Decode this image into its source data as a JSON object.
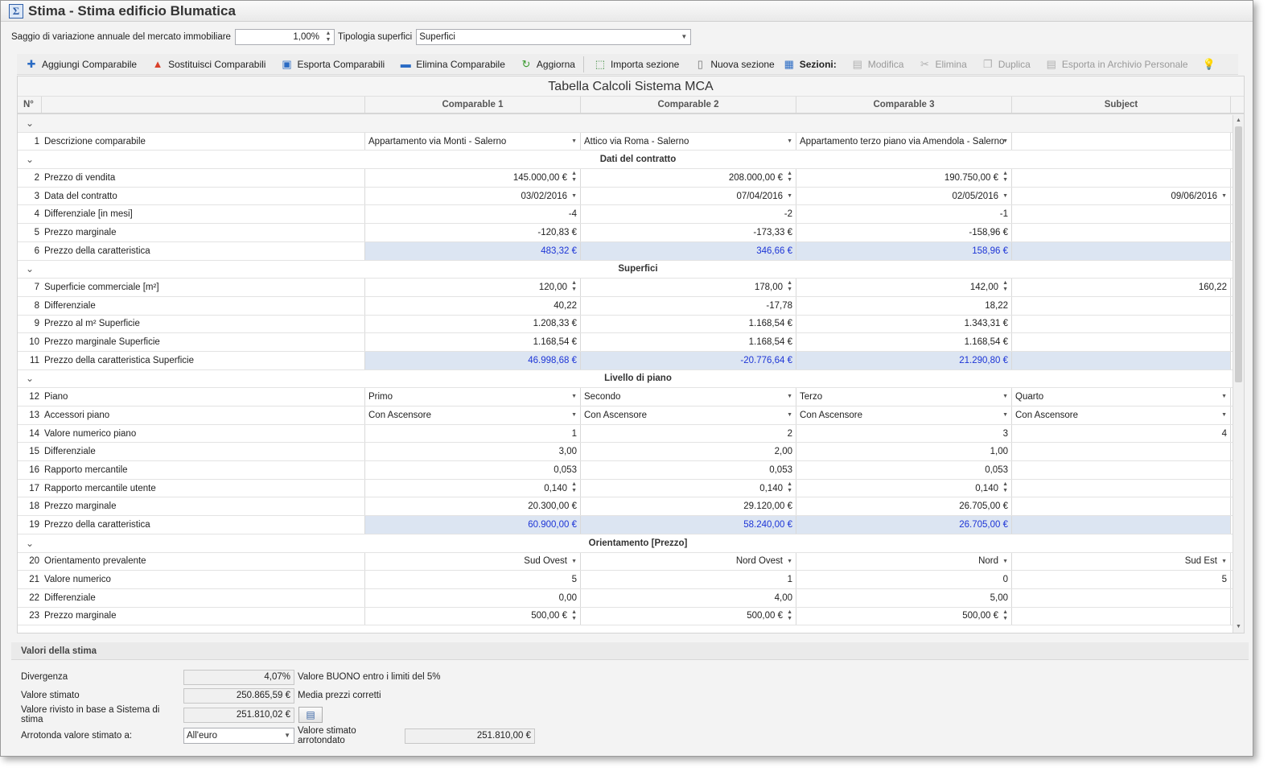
{
  "window": {
    "title": "Stima - Stima edificio Blumatica",
    "app_icon": "sigma-icon"
  },
  "filters": {
    "rate_label": "Saggio di variazione annuale del mercato immobiliare",
    "rate_value": "1,00%",
    "surface_label": "Tipologia superfici",
    "surface_value": "Superfici"
  },
  "toolbar": {
    "add": "Aggiungi Comparabile",
    "replace": "Sostituisci Comparabili",
    "export": "Esporta Comparabili",
    "delete": "Elimina Comparabile",
    "refresh": "Aggiorna",
    "import_section": "Importa sezione",
    "new_section": "Nuova sezione",
    "sections": "Sezioni:",
    "edit": "Modifica",
    "remove": "Elimina",
    "duplicate": "Duplica",
    "archive": "Esporta in Archivio Personale"
  },
  "grid": {
    "caption": "Tabella Calcoli Sistema MCA",
    "headers": {
      "num": "N°",
      "c1": "Comparable 1",
      "c2": "Comparable 2",
      "c3": "Comparable 3",
      "subject": "Subject"
    },
    "collapse_glyph": "⌄",
    "sections": {
      "contratto": "Dati del contratto",
      "superfici": "Superfici",
      "piano": "Livello di piano",
      "orientamento": "Orientamento [Prezzo]"
    },
    "rows": {
      "r1": {
        "n": "1",
        "d": "Descrizione comparabile",
        "c1": "Appartamento via Monti - Salerno",
        "c2": "Attico via Roma - Salerno",
        "c3": "Appartamento terzo piano via Amendola - Salerno",
        "s": ""
      },
      "r2": {
        "n": "2",
        "d": "Prezzo di vendita",
        "c1": "145.000,00 €",
        "c2": "208.000,00 €",
        "c3": "190.750,00 €",
        "s": ""
      },
      "r3": {
        "n": "3",
        "d": "Data del contratto",
        "c1": "03/02/2016",
        "c2": "07/04/2016",
        "c3": "02/05/2016",
        "s": "09/06/2016"
      },
      "r4": {
        "n": "4",
        "d": "Differenziale [in mesi]",
        "c1": "-4",
        "c2": "-2",
        "c3": "-1",
        "s": ""
      },
      "r5": {
        "n": "5",
        "d": "Prezzo marginale",
        "c1": "-120,83 €",
        "c2": "-173,33 €",
        "c3": "-158,96 €",
        "s": ""
      },
      "r6": {
        "n": "6",
        "d": "Prezzo della caratteristica",
        "c1": "483,32 €",
        "c2": "346,66 €",
        "c3": "158,96 €",
        "s": ""
      },
      "r7": {
        "n": "7",
        "d": "Superficie commerciale [m²]",
        "c1": "120,00",
        "c2": "178,00",
        "c3": "142,00",
        "s": "160,22"
      },
      "r8": {
        "n": "8",
        "d": "Differenziale",
        "c1": "40,22",
        "c2": "-17,78",
        "c3": "18,22",
        "s": ""
      },
      "r9": {
        "n": "9",
        "d": "Prezzo al m² Superficie",
        "c1": "1.208,33 €",
        "c2": "1.168,54 €",
        "c3": "1.343,31 €",
        "s": ""
      },
      "r10": {
        "n": "10",
        "d": "Prezzo marginale Superficie",
        "c1": "1.168,54 €",
        "c2": "1.168,54 €",
        "c3": "1.168,54 €",
        "s": ""
      },
      "r11": {
        "n": "11",
        "d": "Prezzo della caratteristica Superficie",
        "c1": "46.998,68 €",
        "c2": "-20.776,64 €",
        "c3": "21.290,80 €",
        "s": ""
      },
      "r12": {
        "n": "12",
        "d": "Piano",
        "c1": "Primo",
        "c2": "Secondo",
        "c3": "Terzo",
        "s": "Quarto"
      },
      "r13": {
        "n": "13",
        "d": "Accessori piano",
        "c1": "Con Ascensore",
        "c2": "Con Ascensore",
        "c3": "Con Ascensore",
        "s": "Con Ascensore"
      },
      "r14": {
        "n": "14",
        "d": "Valore numerico piano",
        "c1": "1",
        "c2": "2",
        "c3": "3",
        "s": "4"
      },
      "r15": {
        "n": "15",
        "d": "Differenziale",
        "c1": "3,00",
        "c2": "2,00",
        "c3": "1,00",
        "s": ""
      },
      "r16": {
        "n": "16",
        "d": "Rapporto mercantile",
        "c1": "0,053",
        "c2": "0,053",
        "c3": "0,053",
        "s": ""
      },
      "r17": {
        "n": "17",
        "d": "Rapporto mercantile utente",
        "c1": "0,140",
        "c2": "0,140",
        "c3": "0,140",
        "s": ""
      },
      "r18": {
        "n": "18",
        "d": "Prezzo marginale",
        "c1": "20.300,00 €",
        "c2": "29.120,00 €",
        "c3": "26.705,00 €",
        "s": ""
      },
      "r19": {
        "n": "19",
        "d": "Prezzo della caratteristica",
        "c1": "60.900,00 €",
        "c2": "58.240,00 €",
        "c3": "26.705,00 €",
        "s": ""
      },
      "r20": {
        "n": "20",
        "d": "Orientamento prevalente",
        "c1": "Sud Ovest",
        "c2": "Nord Ovest",
        "c3": "Nord",
        "s": "Sud Est"
      },
      "r21": {
        "n": "21",
        "d": "Valore numerico",
        "c1": "5",
        "c2": "1",
        "c3": "0",
        "s": "5"
      },
      "r22": {
        "n": "22",
        "d": "Differenziale",
        "c1": "0,00",
        "c2": "4,00",
        "c3": "5,00",
        "s": ""
      },
      "r23": {
        "n": "23",
        "d": "Prezzo marginale",
        "c1": "500,00 €",
        "c2": "500,00 €",
        "c3": "500,00 €",
        "s": ""
      }
    }
  },
  "valori": {
    "title": "Valori della stima",
    "divergenza_label": "Divergenza",
    "divergenza_value": "4,07%",
    "divergenza_note": "Valore BUONO entro i limiti del 5%",
    "stimato_label": "Valore stimato",
    "stimato_value": "250.865,59 €",
    "stimato_note": "Media prezzi corretti",
    "rivisto_label": "Valore rivisto in base a Sistema di stima",
    "rivisto_value": "251.810,02 €",
    "arrotonda_label": "Arrotonda valore stimato a:",
    "arrotonda_value": "All'euro",
    "arrotondato_label": "Valore stimato arrotondato",
    "arrotondato_value": "251.810,00 €"
  },
  "colors": {
    "highlight_bg": "#dce5f2",
    "highlight_text": "#1d35d6",
    "toolbar_icon": "#2a6bc4"
  }
}
